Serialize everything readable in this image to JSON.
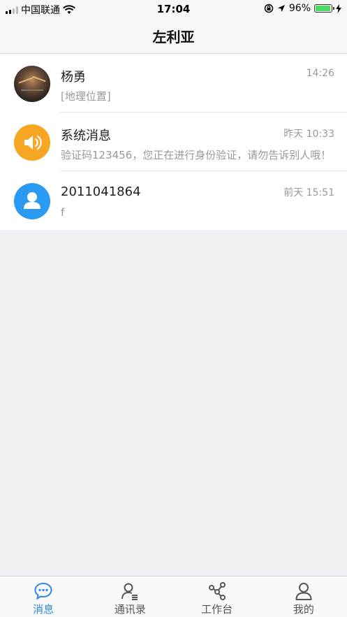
{
  "status_bar": {
    "carrier": "中国联通",
    "time": "17:04",
    "battery": "96%",
    "battery_level": 0.96
  },
  "header": {
    "title": "左利亚"
  },
  "conversations": [
    {
      "name": "杨勇",
      "time": "14:26",
      "preview": "[地理位置]",
      "avatar": "photo-avatar"
    },
    {
      "name": "系统消息",
      "time": "昨天 10:33",
      "preview": "验证码123456，您正在进行身份验证，请勿告诉别人哦！",
      "avatar": "speaker-icon"
    },
    {
      "name": "2011041864",
      "time": "前天 15:51",
      "preview": "f",
      "avatar": "person-icon"
    }
  ],
  "tab_bar": {
    "tabs": [
      {
        "label": "消息",
        "icon": "chat-bubble-icon",
        "active": true
      },
      {
        "label": "通讯录",
        "icon": "contacts-icon",
        "active": false
      },
      {
        "label": "工作台",
        "icon": "share-nodes-icon",
        "active": false
      },
      {
        "label": "我的",
        "icon": "person-outline-icon",
        "active": false
      }
    ]
  },
  "colors": {
    "accent": "#2f86e6",
    "orange_avatar": "#f7a623",
    "blue_avatar": "#2b9af3",
    "battery": "#4cd964"
  }
}
